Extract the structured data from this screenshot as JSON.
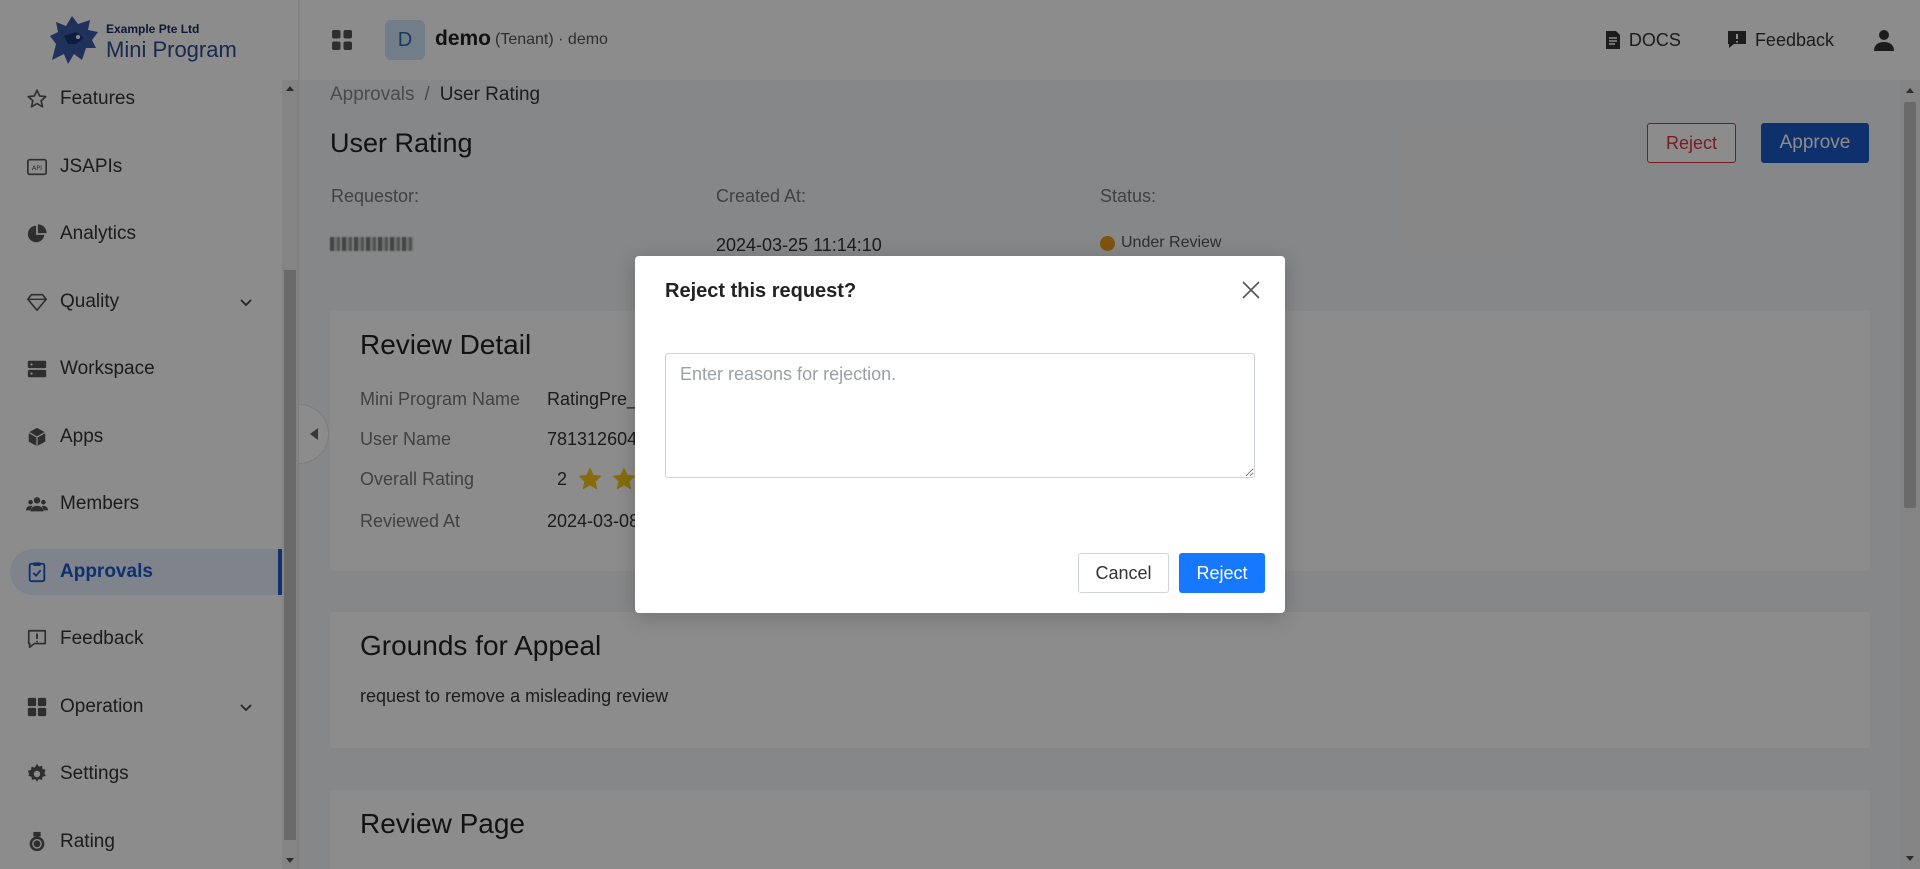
{
  "brand": {
    "company": "Example Pte Ltd",
    "product": "Mini Program"
  },
  "sidebar": {
    "items": [
      {
        "label": "Features",
        "icon": "star-icon"
      },
      {
        "label": "JSAPIs",
        "icon": "api-icon"
      },
      {
        "label": "Analytics",
        "icon": "pie-chart-icon"
      },
      {
        "label": "Quality",
        "icon": "diamond-icon",
        "expandable": true
      },
      {
        "label": "Workspace",
        "icon": "server-icon"
      },
      {
        "label": "Apps",
        "icon": "cube-icon"
      },
      {
        "label": "Members",
        "icon": "team-icon"
      },
      {
        "label": "Approvals",
        "icon": "clipboard-check-icon",
        "active": true
      },
      {
        "label": "Feedback",
        "icon": "message-alert-icon"
      },
      {
        "label": "Operation",
        "icon": "grid-icon",
        "expandable": true
      },
      {
        "label": "Settings",
        "icon": "gear-icon"
      },
      {
        "label": "Rating",
        "icon": "medal-icon"
      }
    ]
  },
  "header": {
    "tenant_initial": "D",
    "tenant_name": "demo",
    "tenant_role": "(Tenant) · demo",
    "docs_label": "DOCS",
    "feedback_label": "Feedback"
  },
  "breadcrumb": {
    "parent": "Approvals",
    "separator": "/",
    "current": "User Rating"
  },
  "page": {
    "title": "User Rating",
    "reject_label": "Reject",
    "approve_label": "Approve",
    "requestor_label": "Requestor:",
    "created_at_label": "Created At:",
    "status_label": "Status:",
    "created_at": "2024-03-25 11:14:10",
    "status": "Under Review",
    "status_color": "#e69a1c"
  },
  "review_detail": {
    "title": "Review Detail",
    "mini_program_name_label": "Mini Program Name",
    "mini_program_name": "RatingPre_",
    "user_name_label": "User Name",
    "user_name": "781312604",
    "overall_rating_label": "Overall Rating",
    "overall_rating": "2",
    "reviewed_at_label": "Reviewed At",
    "reviewed_at": "2024-03-08"
  },
  "appeal": {
    "title": "Grounds for Appeal",
    "text": "request to remove a misleading review"
  },
  "review_page": {
    "title": "Review Page"
  },
  "dialog": {
    "title": "Reject this request?",
    "placeholder": "Enter reasons for rejection.",
    "value": "",
    "cancel_label": "Cancel",
    "confirm_label": "Reject"
  },
  "colors": {
    "primary": "#1a58c7",
    "dialog_primary": "#1677ff",
    "danger": "#d9363e",
    "star": "#f5c518"
  }
}
